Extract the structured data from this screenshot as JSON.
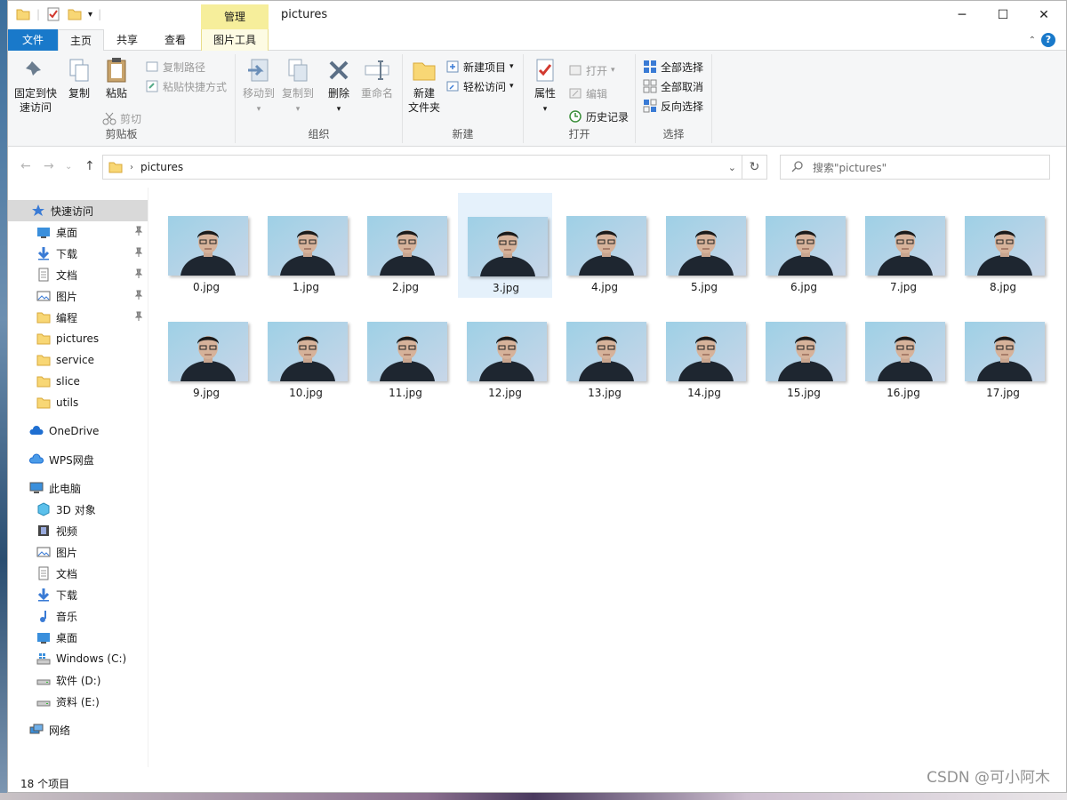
{
  "window": {
    "title": "pictures",
    "min": "─",
    "max": "☐",
    "close": "✕"
  },
  "ribbon_tabs": [
    {
      "label": "文件"
    },
    {
      "label": "主页"
    },
    {
      "label": "共享"
    },
    {
      "label": "查看"
    },
    {
      "label": "图片工具"
    }
  ],
  "context_tab_header": "管理",
  "ribbon": {
    "clipboard": {
      "label": "剪贴板",
      "pin": "固定到快\n速访问",
      "pin_l1": "固定到快",
      "pin_l2": "速访问",
      "copy": "复制",
      "paste": "粘贴",
      "copy_path": "复制路径",
      "paste_shortcut": "粘贴快捷方式",
      "cut": "剪切"
    },
    "organize": {
      "label": "组织",
      "move_to": "移动到",
      "copy_to": "复制到",
      "delete": "删除",
      "rename": "重命名"
    },
    "new": {
      "label": "新建",
      "new_folder_l1": "新建",
      "new_folder_l2": "文件夹",
      "new_item": "新建项目",
      "easy_access": "轻松访问"
    },
    "open": {
      "label": "打开",
      "properties": "属性",
      "open": "打开",
      "edit": "编辑",
      "history": "历史记录"
    },
    "select": {
      "label": "选择",
      "select_all": "全部选择",
      "select_none": "全部取消",
      "invert": "反向选择"
    }
  },
  "address": {
    "path": "pictures",
    "search_placeholder": "搜索\"pictures\""
  },
  "nav_pane": {
    "quick_access": "快速访问",
    "quick_items": [
      "桌面",
      "下载",
      "文档",
      "图片",
      "编程",
      "pictures",
      "service",
      "slice",
      "utils"
    ],
    "onedrive": "OneDrive",
    "wps": "WPS网盘",
    "this_pc": "此电脑",
    "pc_items": [
      "3D 对象",
      "视频",
      "图片",
      "文档",
      "下载",
      "音乐",
      "桌面",
      "Windows (C:)",
      "软件 (D:)",
      "资料 (E:)"
    ],
    "network": "网络"
  },
  "files": [
    "0.jpg",
    "1.jpg",
    "2.jpg",
    "3.jpg",
    "4.jpg",
    "5.jpg",
    "6.jpg",
    "7.jpg",
    "8.jpg",
    "9.jpg",
    "10.jpg",
    "11.jpg",
    "12.jpg",
    "13.jpg",
    "14.jpg",
    "15.jpg",
    "16.jpg",
    "17.jpg"
  ],
  "selected_file": "3.jpg",
  "status": {
    "count": "18 个项目"
  },
  "watermark": "CSDN @可小阿木",
  "colors": {
    "file_tab": "#1979ca",
    "context_tab": "#f6ee9b",
    "selection": "#e5f1fb",
    "folder": "#f8d775"
  }
}
